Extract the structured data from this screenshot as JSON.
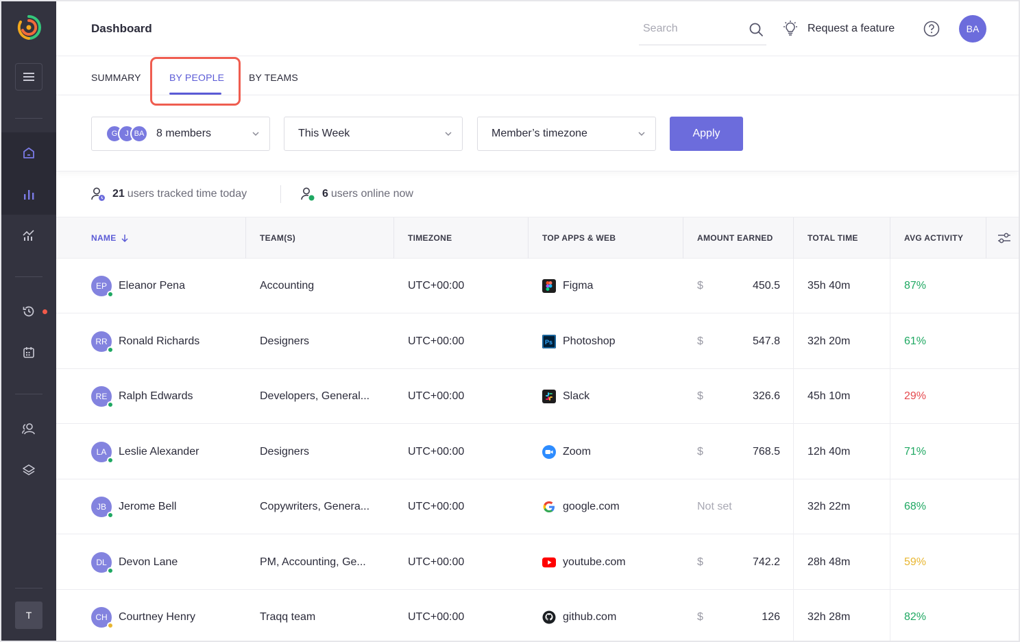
{
  "header": {
    "title": "Dashboard",
    "search_placeholder": "Search",
    "request_feature": "Request a feature",
    "user_initials": "BA"
  },
  "sidebar": {
    "user_initial": "T",
    "history_notification": true
  },
  "tabs": [
    {
      "label": "SUMMARY",
      "active": false
    },
    {
      "label": "BY PEOPLE",
      "active": true
    },
    {
      "label": "BY TEAMS",
      "active": false
    }
  ],
  "filters": {
    "members_label": "8 members",
    "member_avatars": [
      "G",
      "J",
      "BA"
    ],
    "period": "This Week",
    "timezone": "Member’s timezone",
    "apply_label": "Apply"
  },
  "stats": {
    "tracked_count": "21",
    "tracked_text": "users tracked time today",
    "online_count": "6",
    "online_text": "users online now"
  },
  "table": {
    "columns": [
      "NAME",
      "TEAM(S)",
      "TIMEZONE",
      "TOP APPS & WEB",
      "AMOUNT EARNED",
      "TOTAL TIME",
      "AVG ACTIVITY"
    ],
    "currency_symbol": "$",
    "rows": [
      {
        "initials": "EP",
        "name": "Eleanor Pena",
        "status": "online",
        "teams": "Accounting",
        "timezone": "UTC+00:00",
        "app": "Figma",
        "app_icon": "figma-icon",
        "amount": "450.5",
        "total_time": "35h 40m",
        "activity": "87%",
        "activity_color": "#1fa862"
      },
      {
        "initials": "RR",
        "name": "Ronald Richards",
        "status": "online",
        "teams": "Designers",
        "timezone": "UTC+00:00",
        "app": "Photoshop",
        "app_icon": "photoshop-icon",
        "amount": "547.8",
        "total_time": "32h 20m",
        "activity": "61%",
        "activity_color": "#1fa862"
      },
      {
        "initials": "RE",
        "name": "Ralph Edwards",
        "status": "online",
        "teams": "Developers, General...",
        "timezone": "UTC+00:00",
        "app": "Slack",
        "app_icon": "slack-icon",
        "amount": "326.6",
        "total_time": "45h 10m",
        "activity": "29%",
        "activity_color": "#e5484d"
      },
      {
        "initials": "LA",
        "name": "Leslie Alexander",
        "status": "online",
        "teams": "Designers",
        "timezone": "UTC+00:00",
        "app": "Zoom",
        "app_icon": "zoom-icon",
        "amount": "768.5",
        "total_time": "12h 40m",
        "activity": "71%",
        "activity_color": "#1fa862"
      },
      {
        "initials": "JB",
        "name": "Jerome Bell",
        "status": "online",
        "teams": "Copywriters, Genera...",
        "timezone": "UTC+00:00",
        "app": "google.com",
        "app_icon": "google-icon",
        "amount": "Not set",
        "total_time": "32h 22m",
        "activity": "68%",
        "activity_color": "#1fa862"
      },
      {
        "initials": "DL",
        "name": "Devon Lane",
        "status": "online",
        "teams": "PM, Accounting, Ge...",
        "timezone": "UTC+00:00",
        "app": "youtube.com",
        "app_icon": "youtube-icon",
        "amount": "742.2",
        "total_time": "28h 48m",
        "activity": "59%",
        "activity_color": "#e8b631"
      },
      {
        "initials": "CH",
        "name": "Courtney Henry",
        "status": "away",
        "teams": "Traqq team",
        "timezone": "UTC+00:00",
        "app": "github.com",
        "app_icon": "github-icon",
        "amount": "126",
        "total_time": "32h 28m",
        "activity": "82%",
        "activity_color": "#1fa862"
      }
    ]
  },
  "colors": {
    "accent": "#5b5bd6",
    "sidebar_bg": "#33333f",
    "online": "#1fa862",
    "away": "#e8b631",
    "highlight": "#ef5d50"
  }
}
